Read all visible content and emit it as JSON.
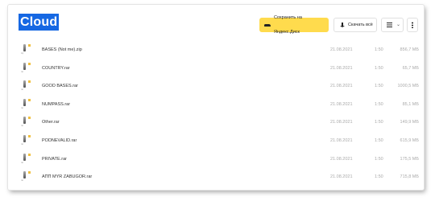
{
  "header": {
    "title": "Cloud",
    "save_button": "Сохранить на Яндекс.Диск",
    "download_button": "Скачать всё",
    "view_toggle_caret": "⌄"
  },
  "files": [
    {
      "name": "BASES (Not me).zip",
      "ext": "zip",
      "date": "21.08.2021",
      "time": "1:50",
      "size": "856,7 МБ"
    },
    {
      "name": "COUNTRY.rar",
      "ext": "rar",
      "date": "21.08.2021",
      "time": "1:50",
      "size": "65,7 МБ"
    },
    {
      "name": "GOOD BASES.rar",
      "ext": "rar",
      "date": "21.08.2021",
      "time": "1:50",
      "size": "1000,5 МБ"
    },
    {
      "name": "NUMPASS.rar",
      "ext": "rar",
      "date": "21.08.2021",
      "time": "1:50",
      "size": "85,1 МБ"
    },
    {
      "name": "Other.rar",
      "ext": "rar",
      "date": "21.08.2021",
      "time": "1:50",
      "size": "149,9 МБ"
    },
    {
      "name": "PODNEVALID.rar",
      "ext": "rar",
      "date": "21.08.2021",
      "time": "1:50",
      "size": "615,9 МБ"
    },
    {
      "name": "PRIVATE.rar",
      "ext": "rar",
      "date": "21.08.2021",
      "time": "1:50",
      "size": "175,5 МБ"
    },
    {
      "name": "АПП MYR ZABUGOR.rar",
      "ext": "rar",
      "date": "21.08.2021",
      "time": "1:50",
      "size": "715,8 МБ"
    }
  ]
}
